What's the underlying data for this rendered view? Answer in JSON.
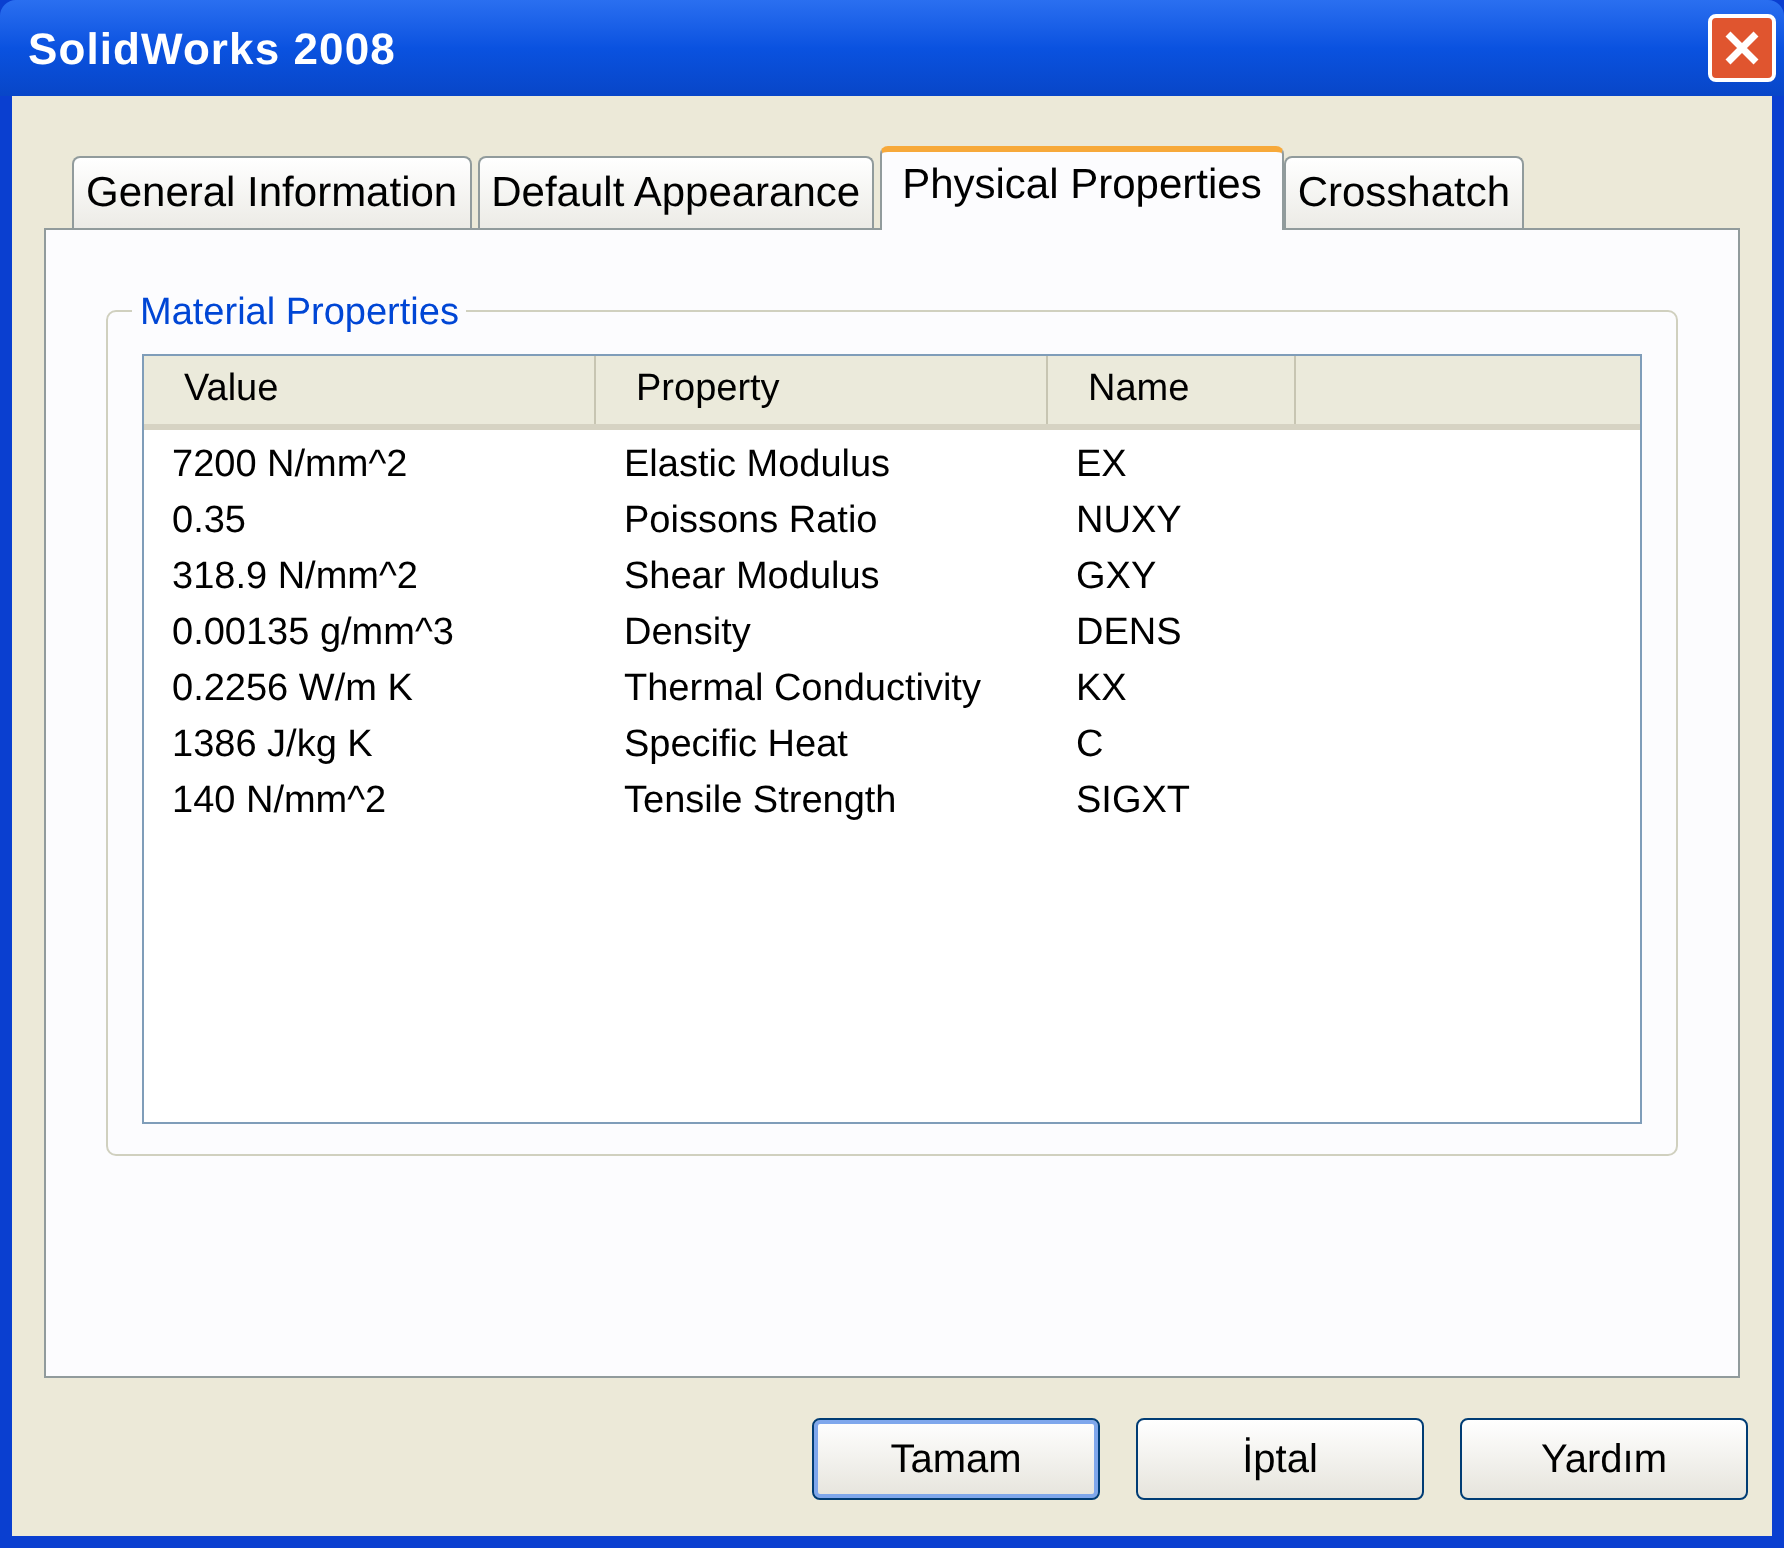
{
  "window": {
    "title": "SolidWorks 2008"
  },
  "tabs": [
    {
      "label": "General Information",
      "selected": false
    },
    {
      "label": "Default Appearance",
      "selected": false
    },
    {
      "label": "Physical Properties",
      "selected": true
    },
    {
      "label": "Crosshatch",
      "selected": false
    }
  ],
  "group": {
    "title": "Material Properties"
  },
  "table": {
    "columns": [
      "Value",
      "Property",
      "Name"
    ],
    "rows": [
      [
        "7200 N/mm^2",
        "Elastic Modulus",
        "EX"
      ],
      [
        "0.35",
        "Poissons Ratio",
        "NUXY"
      ],
      [
        "318.9 N/mm^2",
        "Shear Modulus",
        "GXY"
      ],
      [
        "0.00135 g/mm^3",
        "Density",
        "DENS"
      ],
      [
        "0.2256 W/m K",
        "Thermal Conductivity",
        "KX"
      ],
      [
        "1386 J/kg K",
        "Specific Heat",
        "C"
      ],
      [
        "140 N/mm^2",
        "Tensile Strength",
        "SIGXT"
      ]
    ]
  },
  "buttons": [
    {
      "label": "Tamam",
      "default": true
    },
    {
      "label": "İptal",
      "default": false
    },
    {
      "label": "Yardım",
      "default": false
    }
  ]
}
